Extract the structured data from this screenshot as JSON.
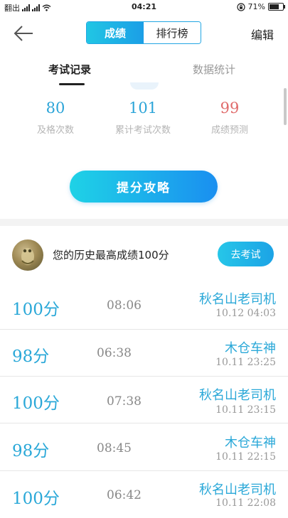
{
  "status_bar": {
    "carrier": "翻出",
    "time": "04:21",
    "battery_percent": "71%",
    "battery_level": 0.71
  },
  "header": {
    "back_icon": "arrow-left-icon",
    "tabs": [
      {
        "label": "成绩",
        "active": true
      },
      {
        "label": "排行榜",
        "active": false
      }
    ],
    "edit_label": "编辑"
  },
  "sub_tabs": [
    {
      "label": "考试记录",
      "active": true
    },
    {
      "label": "数据统计",
      "active": false
    }
  ],
  "stats": [
    {
      "value": "80",
      "label": "及格次数",
      "color": "#2ba4d8"
    },
    {
      "value": "101",
      "label": "累计考试次数",
      "color": "#2ba4d8"
    },
    {
      "value": "99",
      "label": "成绩预测",
      "color": "#e06b6b"
    }
  ],
  "tips_button": "提分攻略",
  "best": {
    "text": "您的历史最高成绩100分",
    "button": "去考试"
  },
  "records": [
    {
      "score": "100分",
      "duration": "08:06",
      "title": "秋名山老司机",
      "date": "10.12  04:03"
    },
    {
      "score": "98分",
      "duration": "06:38",
      "title": "木仓车神",
      "date": "10.11  23:25"
    },
    {
      "score": "100分",
      "duration": "07:38",
      "title": "秋名山老司机",
      "date": "10.11  23:15"
    },
    {
      "score": "98分",
      "duration": "08:45",
      "title": "木仓车神",
      "date": "10.11  22:15"
    },
    {
      "score": "100分",
      "duration": "06:42",
      "title": "秋名山老司机",
      "date": "10.11  22:08"
    }
  ]
}
